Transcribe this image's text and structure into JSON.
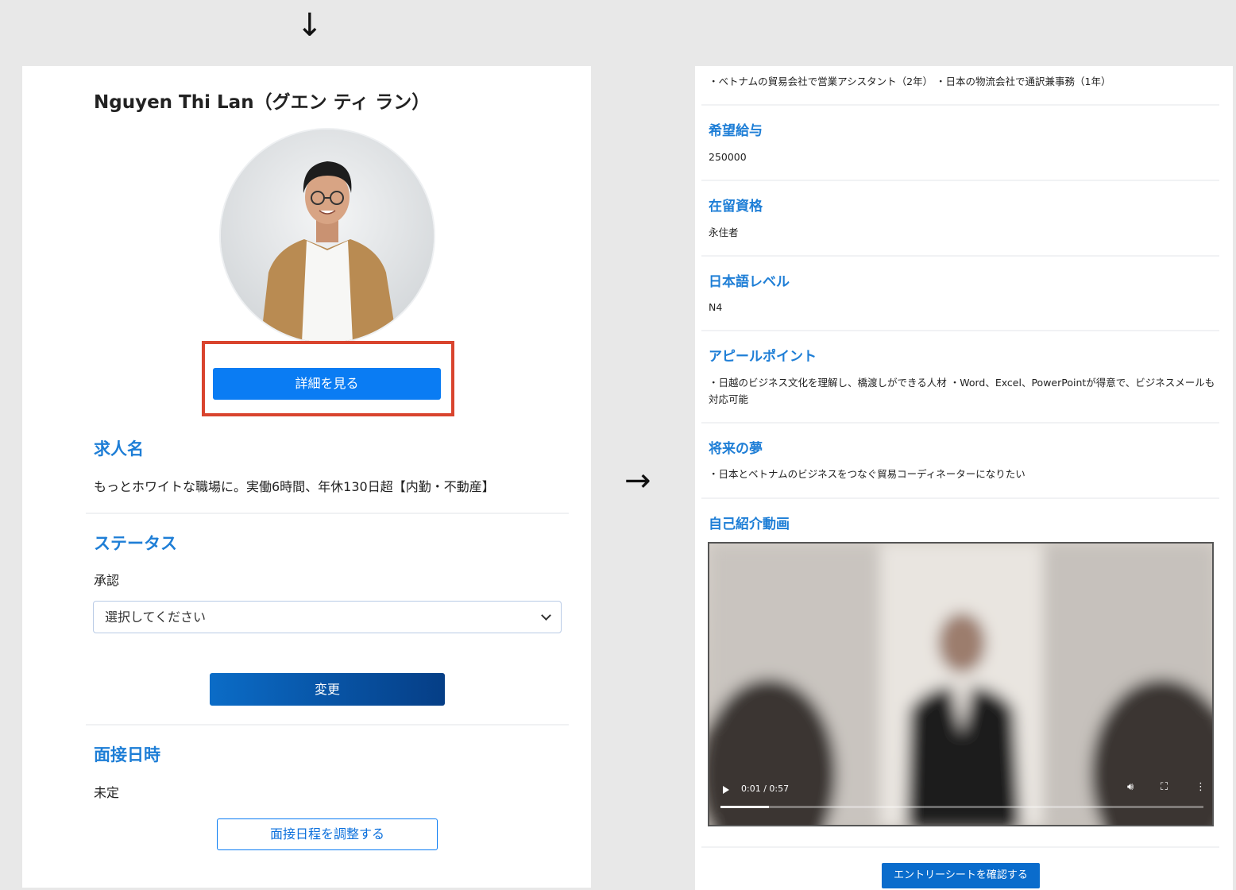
{
  "arrows": {
    "down": "↓",
    "right": "→"
  },
  "left": {
    "name": "Nguyen Thi Lan（グエン ティ ラン）",
    "detail_button": "詳細を見る",
    "job": {
      "heading": "求人名",
      "value": "もっとホワイトな職場に。実働6時間、年休130日超【内勤・不動産】"
    },
    "status": {
      "heading": "ステータス",
      "value": "承認",
      "select_placeholder": "選択してください",
      "change_button": "変更"
    },
    "interview": {
      "heading": "面接日時",
      "value": "未定",
      "schedule_button": "面接日程を調整する"
    }
  },
  "right": {
    "career_text": "・ベトナムの貿易会社で営業アシスタント（2年） ・日本の物流会社で通訳兼事務（1年）",
    "salary": {
      "heading": "希望給与",
      "value": "250000"
    },
    "visa": {
      "heading": "在留資格",
      "value": "永住者"
    },
    "japanese": {
      "heading": "日本語レベル",
      "value": "N4"
    },
    "appeal": {
      "heading": "アピールポイント",
      "value": "・日越のビジネス文化を理解し、橋渡しができる人材 ・Word、Excel、PowerPointが得意で、ビジネスメールも対応可能"
    },
    "dream": {
      "heading": "将来の夢",
      "value": "・日本とベトナムのビジネスをつなぐ貿易コーディネーターになりたい"
    },
    "video": {
      "heading": "自己紹介動画",
      "time": "0:01 / 0:57",
      "progress": 0.1
    },
    "entry_button": "エントリーシートを確認する"
  },
  "colors": {
    "accent": "#1e7ed6",
    "button": "#0a7cf3",
    "highlight": "#d9442e"
  }
}
